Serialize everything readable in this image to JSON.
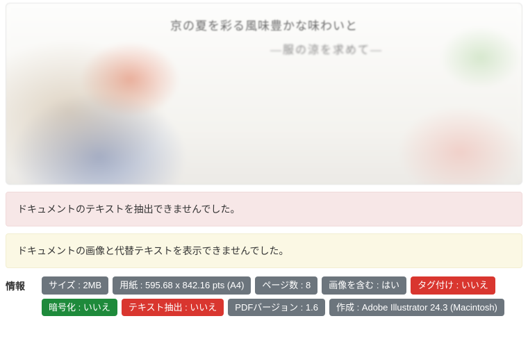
{
  "hero": {
    "line1": "京の夏を彩る風味豊かな味わいと",
    "line2": "―服の涼を求めて―"
  },
  "alerts": {
    "text_extract_fail": "ドキュメントのテキストを抽出できませんでした。",
    "image_alt_fail": "ドキュメントの画像と代替テキストを表示できませんでした。"
  },
  "info": {
    "heading": "情報",
    "badges": [
      {
        "label": "サイズ : 2MB",
        "color": "gray"
      },
      {
        "label": "用紙 : 595.68 x 842.16 pts (A4)",
        "color": "gray"
      },
      {
        "label": "ページ数 : 8",
        "color": "gray"
      },
      {
        "label": "画像を含む : はい",
        "color": "gray"
      },
      {
        "label": "タグ付け : いいえ",
        "color": "red"
      },
      {
        "label": "暗号化 : いいえ",
        "color": "green"
      },
      {
        "label": "テキスト抽出 : いいえ",
        "color": "red"
      },
      {
        "label": "PDFバージョン : 1.6",
        "color": "gray"
      },
      {
        "label": "作成 : Adobe Illustrator 24.3 (Macintosh)",
        "color": "gray"
      }
    ]
  }
}
